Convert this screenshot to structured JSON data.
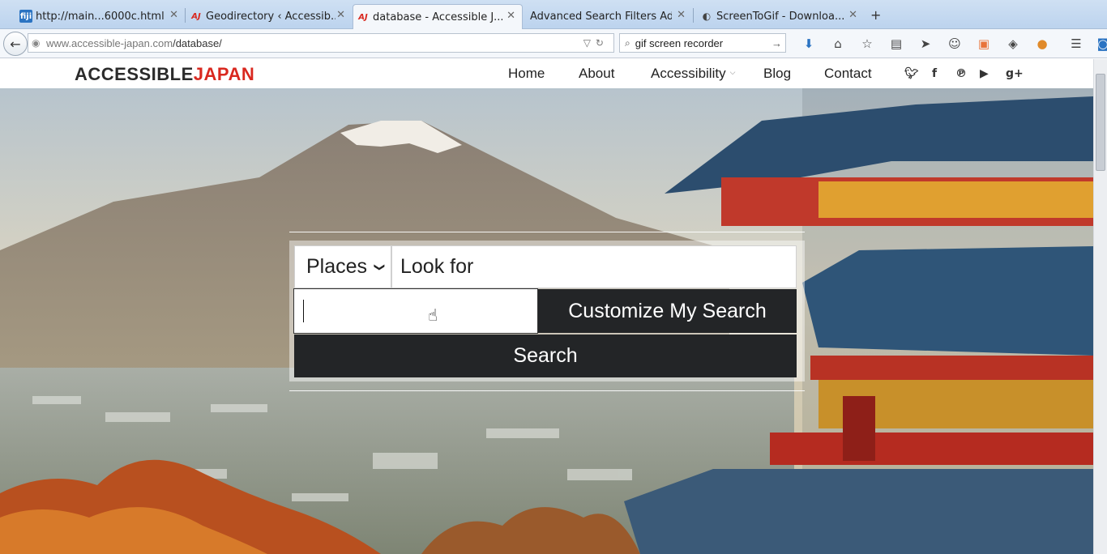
{
  "browser": {
    "tabs": [
      {
        "favicon": "fiji",
        "label": "http://main...6000c.html",
        "active": false
      },
      {
        "favicon": "AJ",
        "label": "Geodirectory ‹ Accessib...",
        "active": false
      },
      {
        "favicon": "AJ",
        "label": "database - Accessible J...",
        "active": true
      },
      {
        "favicon": "",
        "label": "Advanced Search Filters Ad...",
        "active": false
      },
      {
        "favicon": "ScreenToGif",
        "label": "ScreenToGif - Downloa...",
        "active": false
      }
    ],
    "url_host": "www.accessible-japan.com",
    "url_path": "/database/",
    "search_text": "gif screen recorder",
    "toolbar_icons": [
      "download-icon",
      "home-icon",
      "bookmark-star-icon",
      "reading-list-icon",
      "send-icon",
      "chat-icon",
      "pocket-icon",
      "layers-icon",
      "extension-icon",
      "menu-icon",
      "account-icon"
    ]
  },
  "site": {
    "logo_part1": "ACCESSIBLE",
    "logo_part2": "JAPAN",
    "logo_colors": {
      "part1": "#2b2b2b",
      "part2": "#d9281f"
    },
    "nav": {
      "home": "Home",
      "about": "About",
      "accessibility": "Accessibility",
      "blog": "Blog",
      "contact": "Contact"
    },
    "social_icons": [
      "twitter-icon",
      "facebook-icon",
      "pinterest-icon",
      "youtube-icon",
      "google-plus-icon"
    ]
  },
  "search": {
    "type_selected": "Places",
    "look_for_placeholder": "Look for",
    "near_value": "",
    "customize_label": "Customize My Search",
    "search_label": "Search"
  }
}
